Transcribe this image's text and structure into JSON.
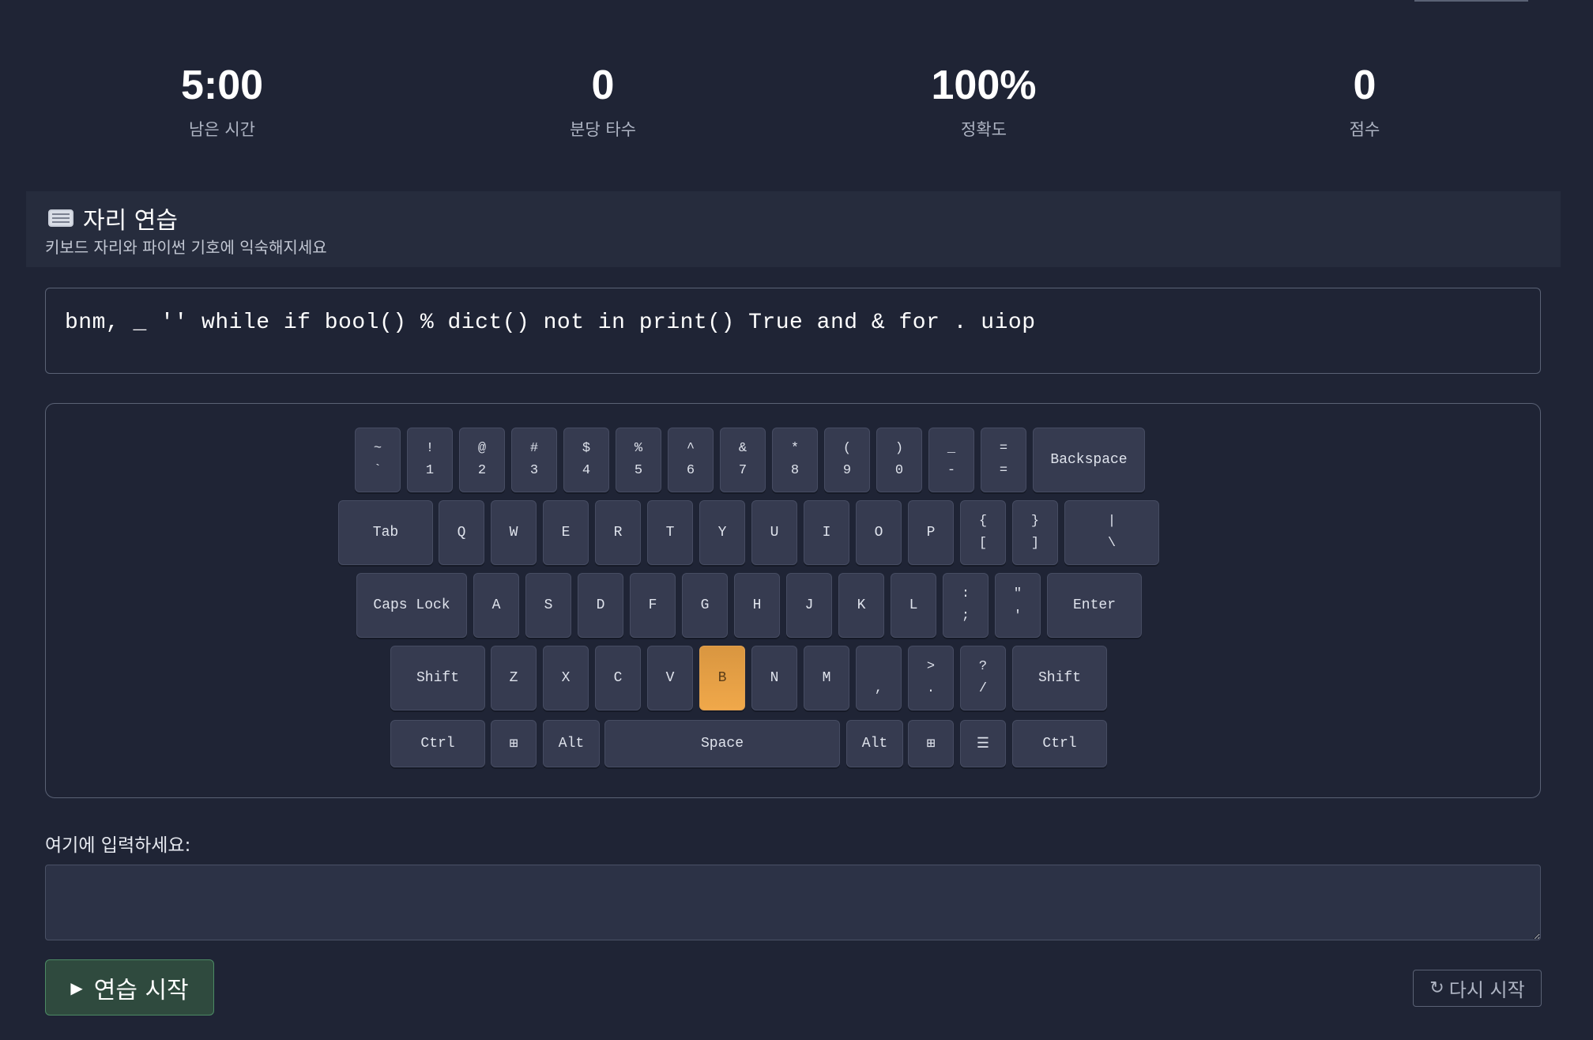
{
  "stats": {
    "time": {
      "value": "5:00",
      "label": "남은 시간"
    },
    "wpm": {
      "value": "0",
      "label": "분당 타수"
    },
    "accuracy": {
      "value": "100%",
      "label": "정확도"
    },
    "score": {
      "value": "0",
      "label": "점수"
    }
  },
  "section": {
    "icon": "keyboard-icon",
    "title": "자리 연습",
    "subtitle": "키보드 자리와 파이썬 기호에 익숙해지세요"
  },
  "target_text": "bnm, _ '' while if bool() % dict() not in print() True and & for . uiop",
  "keyboard": {
    "highlighted_key": "B",
    "row1": [
      {
        "shift": "~",
        "base": "`"
      },
      {
        "shift": "!",
        "base": "1"
      },
      {
        "shift": "@",
        "base": "2"
      },
      {
        "shift": "#",
        "base": "3"
      },
      {
        "shift": "$",
        "base": "4"
      },
      {
        "shift": "%",
        "base": "5"
      },
      {
        "shift": "^",
        "base": "6"
      },
      {
        "shift": "&",
        "base": "7"
      },
      {
        "shift": "*",
        "base": "8"
      },
      {
        "shift": "(",
        "base": "9"
      },
      {
        "shift": ")",
        "base": "0"
      },
      {
        "shift": "_",
        "base": "-"
      },
      {
        "shift": "=",
        "base": "="
      },
      {
        "label": "Backspace"
      }
    ],
    "row2": [
      {
        "label": "Tab"
      },
      {
        "label": "Q"
      },
      {
        "label": "W"
      },
      {
        "label": "E"
      },
      {
        "label": "R"
      },
      {
        "label": "T"
      },
      {
        "label": "Y"
      },
      {
        "label": "U"
      },
      {
        "label": "I"
      },
      {
        "label": "O"
      },
      {
        "label": "P"
      },
      {
        "shift": "{",
        "base": "["
      },
      {
        "shift": "}",
        "base": "]"
      },
      {
        "shift": "|",
        "base": "\\"
      }
    ],
    "row3": [
      {
        "label": "Caps Lock"
      },
      {
        "label": "A"
      },
      {
        "label": "S"
      },
      {
        "label": "D"
      },
      {
        "label": "F"
      },
      {
        "label": "G"
      },
      {
        "label": "H"
      },
      {
        "label": "J"
      },
      {
        "label": "K"
      },
      {
        "label": "L"
      },
      {
        "shift": ":",
        "base": ";"
      },
      {
        "shift": "\"",
        "base": "'"
      },
      {
        "label": "Enter"
      }
    ],
    "row4": [
      {
        "label": "Shift"
      },
      {
        "label": "Z"
      },
      {
        "label": "X"
      },
      {
        "label": "C"
      },
      {
        "label": "V"
      },
      {
        "label": "B"
      },
      {
        "label": "N"
      },
      {
        "label": "M"
      },
      {
        "shift": "",
        "base": ","
      },
      {
        "shift": ">",
        "base": "."
      },
      {
        "shift": "?",
        "base": "/"
      },
      {
        "label": "Shift"
      }
    ],
    "row5": [
      {
        "label": "Ctrl"
      },
      {
        "label": "⊞"
      },
      {
        "label": "Alt"
      },
      {
        "label": "Space"
      },
      {
        "label": "Alt"
      },
      {
        "label": "⊞"
      },
      {
        "label": "☰"
      },
      {
        "label": "Ctrl"
      }
    ]
  },
  "input": {
    "label": "여기에 입력하세요:",
    "value": "",
    "placeholder": ""
  },
  "buttons": {
    "start": "연습 시작",
    "restart": "다시 시작"
  },
  "colors": {
    "background": "#1f2435",
    "highlight": "#f0a84a",
    "start_button": "#2f4a3e"
  }
}
